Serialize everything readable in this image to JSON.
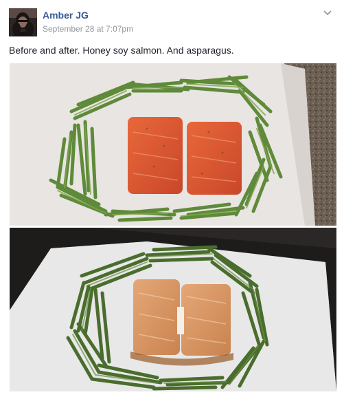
{
  "post": {
    "author": "Amber JG",
    "timestamp": "September 28 at 7:07pm",
    "text": "Before and after. Honey soy salmon. And asparagus."
  },
  "icons": {
    "avatar": "profile-photo",
    "options": "chevron-down-icon"
  },
  "photos": [
    {
      "name": "before-photo"
    },
    {
      "name": "after-photo"
    }
  ],
  "colors": {
    "link": "#365899",
    "meta": "#90949c",
    "text": "#1d2129"
  }
}
